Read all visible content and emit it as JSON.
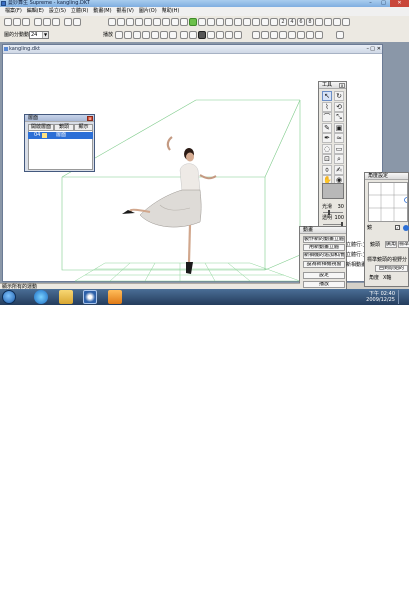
{
  "app": {
    "title": "曼妙舞生 Supreme - kangling.DKT",
    "controls": {
      "minimize": "–",
      "maximize": "□",
      "close": "✕"
    }
  },
  "menu": [
    "檔案(F)",
    "編輯(E)",
    "設立(S)",
    "立體(R)",
    "動畫(M)",
    "觀看(V)",
    "圖片(O)",
    "幫助(H)"
  ],
  "toolbar1": {
    "icons": [
      "open-icon",
      "save-icon",
      "print-icon",
      "cut-icon",
      "copy-icon",
      "paste-icon",
      "undo-icon",
      "redo-icon",
      "view1-icon",
      "view2-icon",
      "view3-icon",
      "view4-icon",
      "view5-icon",
      "view6-icon",
      "view7-icon",
      "view8-icon",
      "view9-icon",
      "green-icon",
      "light-icon",
      "camera-icon",
      "move-icon",
      "rotate-icon",
      "zoom-icon",
      "select-icon",
      "joint-icon",
      "bone-icon",
      "spline-icon",
      "frame2-icon",
      "frame4-icon",
      "frame6-icon",
      "frame8-icon",
      "arrow-up-icon",
      "arrow-down-icon",
      "chart-icon",
      "dots-icon"
    ],
    "icon_labels": {
      "frame2": "2",
      "frame4": "4",
      "frame6": "6",
      "frame8": "8"
    }
  },
  "toolbar2": {
    "fps_label": "圖的分動動",
    "fps_value": "24",
    "play_label": "播放",
    "icons": [
      "rewind-icon",
      "prev-icon",
      "play-icon",
      "pause-icon",
      "stop-icon",
      "next-icon",
      "ffwd-icon",
      "loop-icon",
      "key-icon",
      "record-icon",
      "bone-icon",
      "camera2-icon",
      "light2-icon",
      "render-icon",
      "sphere1-icon",
      "sphere2-icon",
      "sphere3-icon",
      "sphere4-icon",
      "sphere5-icon",
      "sphere6-icon",
      "sphere7-icon",
      "sphere8-icon",
      "help-icon"
    ]
  },
  "document": {
    "title": "kangling.dkt"
  },
  "layer_panel": {
    "title": "層面",
    "columns": [
      "開啟層面",
      "鎖頭",
      "顯示"
    ],
    "rows": [
      {
        "id": "04",
        "name": "層面"
      }
    ]
  },
  "tools_panel": {
    "title": "工具",
    "tools": [
      "arrow",
      "rotate",
      "bone",
      "transform",
      "link",
      "scale",
      "paint",
      "fill",
      "pen",
      "warp",
      "lasso",
      "erase",
      "crop",
      "zoom",
      "dropper",
      "brush",
      "hand",
      "eye"
    ],
    "sliders": [
      {
        "label": "光滑",
        "value": "30",
        "fraction": 0.3
      },
      {
        "label": "透明",
        "value": "100",
        "fraction": 1.0
      }
    ]
  },
  "action_panel": {
    "title": "動畫",
    "buttons": [
      "製作新的動畫立體",
      "用新動畫立體",
      "新相機的追加和/刪除",
      "設為新相機視窗",
      "設定",
      "播放",
      "停止"
    ],
    "side_labels": [
      "立體行:立體",
      "立體行:立體",
      "新相動畫"
    ]
  },
  "angle_panel": {
    "title": "角度設定",
    "labels": [
      "鏡",
      "鏡頭",
      "廣角",
      "標準",
      "標準鏡頭的視野分",
      "回到原始的",
      "角度",
      "X軸"
    ],
    "checkbox_checked": true
  },
  "statusbar": {
    "text": "顯示所有的運動"
  },
  "taskbar": {
    "apps": [
      "ie-icon",
      "explorer-icon",
      "dancer-app-icon",
      "media-icon"
    ],
    "time": "下午 02:40",
    "date": "2009/12/25"
  }
}
